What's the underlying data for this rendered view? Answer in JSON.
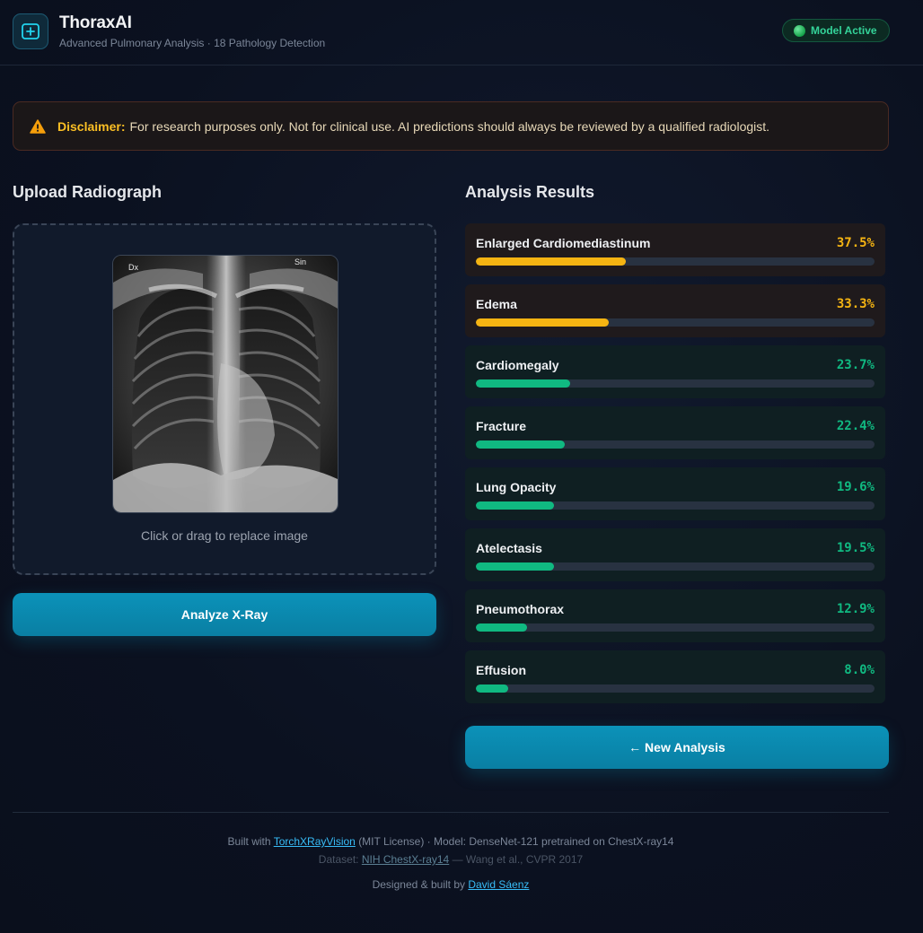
{
  "header": {
    "title": "ThoraxAI",
    "subtitle": "Advanced Pulmonary Analysis · 18 Pathology Detection",
    "logo_icon": "medical-cross-icon",
    "status": "Model Active"
  },
  "disclaimer": {
    "label": "Disclaimer:",
    "text": "For research purposes only. Not for clinical use. AI predictions should always be reviewed by a qualified radiologist."
  },
  "upload": {
    "title": "Upload Radiograph",
    "marker_left": "Dx",
    "marker_right": "Sin",
    "hint": "Click or drag to replace image",
    "analyze_label": "Analyze X-Ray"
  },
  "results": {
    "title": "Analysis Results",
    "items": [
      {
        "label": "Enlarged Cardiomediastinum",
        "value": "37.5%",
        "pct": 37.5,
        "level": "warn"
      },
      {
        "label": "Edema",
        "value": "33.3%",
        "pct": 33.3,
        "level": "warn"
      },
      {
        "label": "Cardiomegaly",
        "value": "23.7%",
        "pct": 23.7,
        "level": "ok"
      },
      {
        "label": "Fracture",
        "value": "22.4%",
        "pct": 22.4,
        "level": "ok"
      },
      {
        "label": "Lung Opacity",
        "value": "19.6%",
        "pct": 19.6,
        "level": "ok"
      },
      {
        "label": "Atelectasis",
        "value": "19.5%",
        "pct": 19.5,
        "level": "ok"
      },
      {
        "label": "Pneumothorax",
        "value": "12.9%",
        "pct": 12.9,
        "level": "ok"
      },
      {
        "label": "Effusion",
        "value": "8.0%",
        "pct": 8.0,
        "level": "ok"
      }
    ],
    "new_analysis_label": "← New Analysis"
  },
  "colors": {
    "warn": "#f5b412",
    "ok": "#10b981",
    "accent": "#0a8fb6"
  },
  "footer": {
    "line1_prefix": "Built with",
    "line1_link": "TorchXRayVision",
    "line1_suffix": "(MIT License) · Model: DenseNet-121 pretrained on ChestX-ray14",
    "line2_prefix": "Dataset:",
    "line2_link": "NIH ChestX-ray14",
    "line2_suffix": "— Wang et al., CVPR 2017",
    "line3_prefix": "Designed & built by",
    "line3_link": "David Sáenz"
  }
}
